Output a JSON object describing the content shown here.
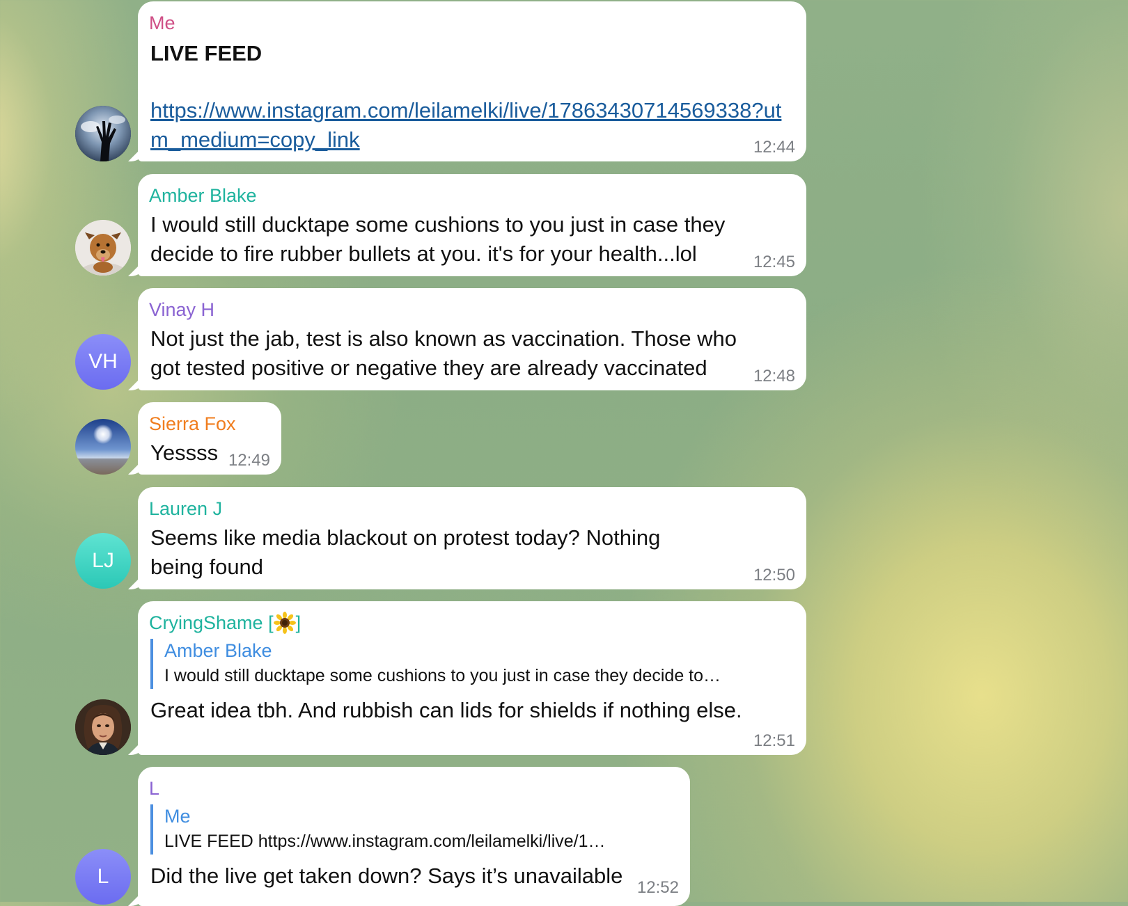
{
  "colors": {
    "me_name": "#cf4f86",
    "amber": "#1fb39e",
    "vinay": "#8a63d2",
    "sierra": "#f07d1e",
    "lauren": "#1fb39e",
    "crying": "#1fb39e",
    "l": "#8a63d2",
    "quote_bar": "#4c8fe0",
    "link": "#1a5c9c"
  },
  "messages": [
    {
      "sender": "Me",
      "title": "LIVE FEED",
      "link": "https://www.instagram.com/leilamelki/live/17863430714569338?utm_medium=copy_link",
      "time": "12:44",
      "avatar_icon": "hand-silhouette-photo"
    },
    {
      "sender": "Amber Blake",
      "text": "I would still ducktape some cushions to you just in case they decide to fire rubber bullets at you. it's for your health...lol",
      "time": "12:45",
      "avatar_icon": "dog-photo"
    },
    {
      "sender": "Vinay H",
      "initials": "VH",
      "text": "Not just the jab, test is also known as vaccination. Those who got tested positive or negative they are already vaccinated",
      "time": "12:48"
    },
    {
      "sender": "Sierra Fox",
      "text": "Yessss",
      "time": "12:49",
      "avatar_icon": "beach-sun-photo"
    },
    {
      "sender": "Lauren J",
      "initials": "LJ",
      "text": "Seems like media blackout on protest today? Nothing being found",
      "time": "12:50"
    },
    {
      "sender": "CryingShame [",
      "sender_suffix": "]",
      "sender_icon": "sunflower-icon",
      "reply_name": "Amber Blake",
      "reply_text": "I would still ducktape some cushions to you just in case they decide to…",
      "text": "Great idea tbh. And rubbish can lids for shields if nothing else.",
      "time": "12:51",
      "avatar_icon": "portrait-painting-photo"
    },
    {
      "sender": "L",
      "initials": "L",
      "reply_name": "Me",
      "reply_text": "LIVE FEED https://www.instagram.com/leilamelki/live/1…",
      "text": "Did the live get taken down? Says it’s unavailable",
      "time": "12:52"
    }
  ]
}
